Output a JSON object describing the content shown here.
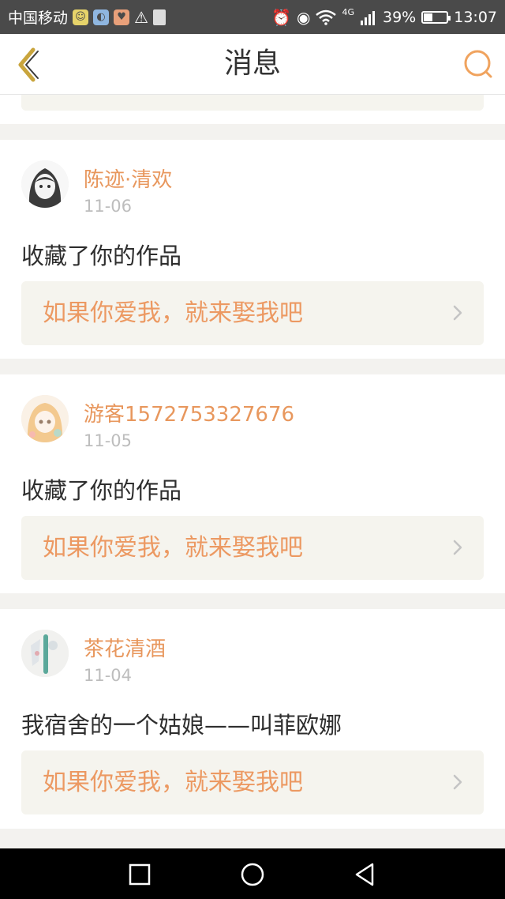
{
  "status_bar": {
    "carrier": "中国移动",
    "signal_text": "4G",
    "battery": "39%",
    "battery_level": 0.39,
    "time": "13:07"
  },
  "header": {
    "title": "消息",
    "back_icon": "chevron-left-icon",
    "search_icon": "search-icon",
    "accent_color": "#f0a35e"
  },
  "messages": [
    {
      "username": "陈迹·清欢",
      "date": "11-06",
      "message": "收藏了你的作品",
      "work_title": "如果你爱我，就来娶我吧"
    },
    {
      "username": "游客1572753327676",
      "date": "11-05",
      "message": "收藏了你的作品",
      "work_title": "如果你爱我，就来娶我吧"
    },
    {
      "username": "茶花清酒",
      "date": "11-04",
      "message": "我宿舍的一个姑娘——叫菲欧娜",
      "work_title": "如果你爱我，就来娶我吧"
    }
  ],
  "system_nav": {
    "recent_icon": "square-icon",
    "home_icon": "circle-icon",
    "back_icon": "triangle-back-icon"
  }
}
